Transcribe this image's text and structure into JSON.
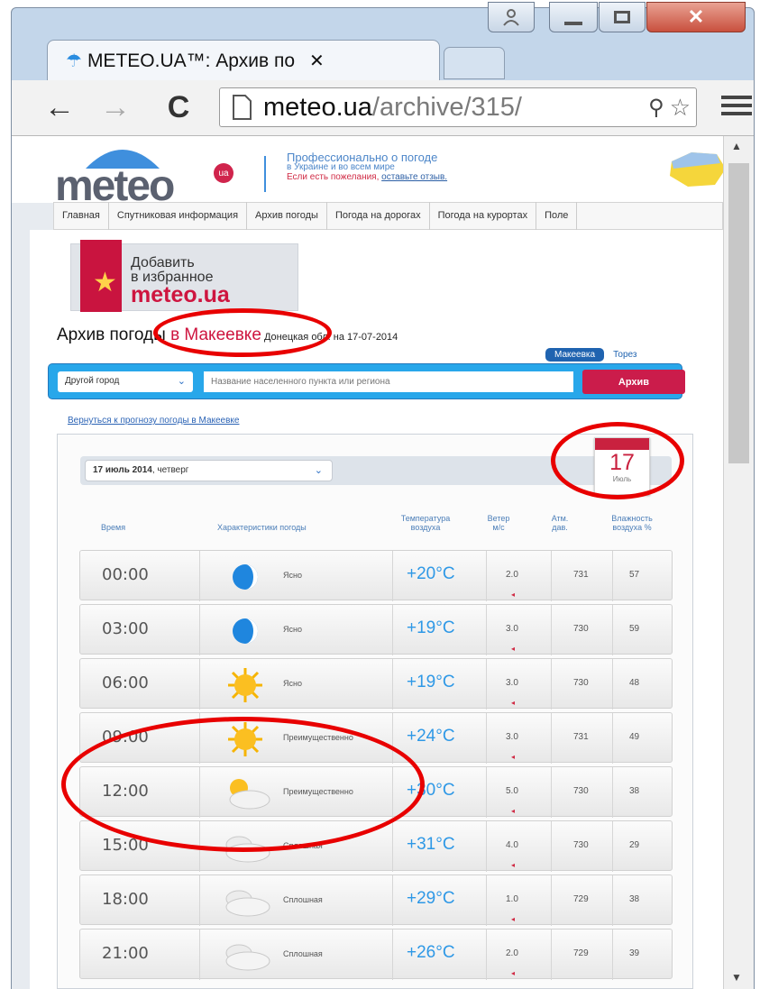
{
  "browser": {
    "tab_title": "METEO.UA™: Архив по",
    "url_host": "meteo.ua",
    "url_path": "/archive/315/"
  },
  "site": {
    "logo_text": "meteo",
    "logo_badge": "ua",
    "tagline_main": "Профессионально о погоде",
    "tagline_sub": "в Украине и во всем мире",
    "feedback_text": "Если есть пожелания,",
    "feedback_link": "оставьте отзыв.",
    "nav_items": [
      "Главная",
      "Спутниковая информация",
      "Архив погоды",
      "Погода на дорогах",
      "Погода на курортах",
      "Поле"
    ]
  },
  "favorites": {
    "line1": "Добавить",
    "line2": "в избранное",
    "line3": "meteo.ua"
  },
  "page": {
    "title_prefix": "Архив погоды ",
    "title_city": "в Макеевке",
    "title_suffix": " Донецкая обл. на 17-07-2014",
    "city_tab_active": "Макеевка",
    "city_tab_other": "Торез"
  },
  "search": {
    "select_value": "Другой город",
    "input_placeholder": "Название населенного пункта или региона",
    "button_label": "Архив"
  },
  "back_link": "Вернуться к прогнозу погоды в Макеевке",
  "archive": {
    "date_value": "17 июль 2014",
    "weekday": ", четверг",
    "calendar_day": "17",
    "calendar_month": "Июль",
    "column_headers": {
      "time": "Время",
      "conditions": "Характеристики погоды",
      "temp_line1": "Температура",
      "temp_line2": "воздуха",
      "wind_line1": "Ветер",
      "wind_line2": "м/с",
      "press_line1": "Атм.",
      "press_line2": "дав.",
      "hum_line1": "Влажность",
      "hum_line2": "воздуха %"
    },
    "rows": [
      {
        "time": "00:00",
        "icon": "moon-icon",
        "desc": "Ясно",
        "temp": "+20°C",
        "wind": "2.0",
        "pressure": "731",
        "humidity": "57"
      },
      {
        "time": "03:00",
        "icon": "moon-icon",
        "desc": "Ясно",
        "temp": "+19°C",
        "wind": "3.0",
        "pressure": "730",
        "humidity": "59"
      },
      {
        "time": "06:00",
        "icon": "sun-icon",
        "desc": "Ясно",
        "temp": "+19°C",
        "wind": "3.0",
        "pressure": "730",
        "humidity": "48"
      },
      {
        "time": "09:00",
        "icon": "sun-icon",
        "desc": "Преимущественно",
        "temp": "+24°C",
        "wind": "3.0",
        "pressure": "731",
        "humidity": "49"
      },
      {
        "time": "12:00",
        "icon": "partly-cloudy-icon",
        "desc": "Преимущественно",
        "temp": "+30°C",
        "wind": "5.0",
        "pressure": "730",
        "humidity": "38"
      },
      {
        "time": "15:00",
        "icon": "cloud-icon",
        "desc": "Сплошная",
        "temp": "+31°C",
        "wind": "4.0",
        "pressure": "730",
        "humidity": "29"
      },
      {
        "time": "18:00",
        "icon": "cloud-icon",
        "desc": "Сплошная",
        "temp": "+29°C",
        "wind": "1.0",
        "pressure": "729",
        "humidity": "38"
      },
      {
        "time": "21:00",
        "icon": "cloud-icon",
        "desc": "Сплошная",
        "temp": "+26°C",
        "wind": "2.0",
        "pressure": "729",
        "humidity": "39"
      }
    ]
  },
  "colors": {
    "brand_red": "#ce153f",
    "temp_blue": "#2e98e6",
    "annotation_red": "#e80000"
  }
}
